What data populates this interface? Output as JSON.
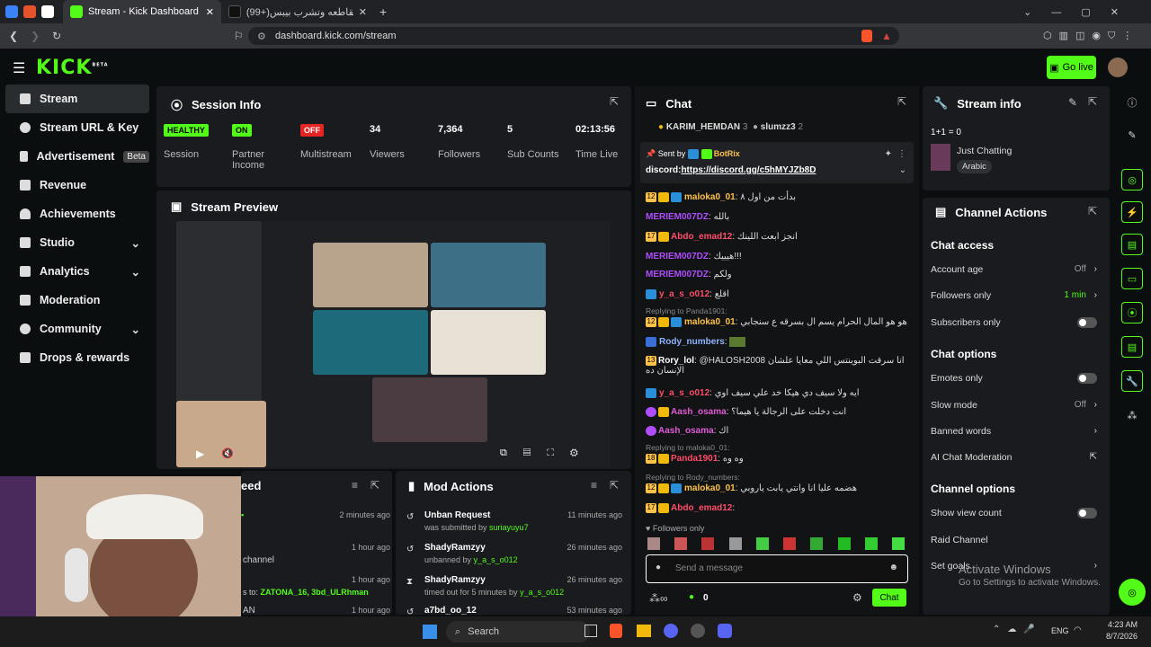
{
  "browser": {
    "tab1": "Stream - Kick Dashboard",
    "tab2": "(99+)متتاش المقاطعه وتشرب بيبس",
    "url": "dashboard.kick.com/stream"
  },
  "header": {
    "logo": "KICK",
    "logo_sup": "BETA",
    "go_live": "Go live"
  },
  "sidebar": {
    "items": [
      {
        "label": "Stream"
      },
      {
        "label": "Stream URL & Key"
      },
      {
        "label": "Advertisement",
        "badge": "Beta"
      },
      {
        "label": "Revenue"
      },
      {
        "label": "Achievements"
      },
      {
        "label": "Studio"
      },
      {
        "label": "Analytics"
      },
      {
        "label": "Moderation"
      },
      {
        "label": "Community"
      },
      {
        "label": "Drops & rewards"
      }
    ]
  },
  "session": {
    "title": "Session Info",
    "stats": [
      {
        "value": "HEALTHY",
        "label": "Session"
      },
      {
        "value": "ON",
        "label": "Partner Income"
      },
      {
        "value": "OFF",
        "label": "Multistream"
      },
      {
        "value": "34",
        "label": "Viewers"
      },
      {
        "value": "7,364",
        "label": "Followers"
      },
      {
        "value": "5",
        "label": "Sub Counts"
      },
      {
        "value": "02:13:56",
        "label": "Time Live"
      }
    ]
  },
  "preview": {
    "title": "Stream Preview"
  },
  "feed": {
    "title": "eed",
    "rows": [
      {
        "time": "2 minutes ago"
      },
      {
        "time": "1 hour ago",
        "text": "channel"
      },
      {
        "time": "1 hour ago",
        "text": "s to:",
        "hl": "ZATONA_16, 3bd_ULRhman"
      },
      {
        "text": "AN",
        "time": "1 hour ago"
      }
    ]
  },
  "modactions": {
    "title": "Mod Actions",
    "rows": [
      {
        "title": "Unban Request",
        "sub": "was submitted by",
        "user": "suriayuyu7",
        "time": "11 minutes ago"
      },
      {
        "title": "ShadyRamzyy",
        "sub": "unbanned by",
        "user": "y_a_s_o012",
        "time": "26 minutes ago"
      },
      {
        "title": "ShadyRamzyy",
        "sub": "timed out for 5 minutes by",
        "user": "y_a_s_o012",
        "time": "26 minutes ago"
      },
      {
        "title": "a7bd_oo_12",
        "time": "53 minutes ago"
      }
    ]
  },
  "chat": {
    "title": "Chat",
    "top_users": [
      {
        "name": "KARIM_HEMDAN",
        "n": "3"
      },
      {
        "name": "slumzz3",
        "n": "2"
      }
    ],
    "pinned": {
      "sent_by": "Sent by",
      "bot": "BotRix",
      "text": "discord:",
      "link": "https://discord.gg/c5hMYJZb8D"
    },
    "messages": [
      {
        "lvl": "12",
        "user": "maloka0_01",
        "text": "بدأت من اول ٨",
        "color": "#ffc24a"
      },
      {
        "user": "MERIEM007DZ",
        "text": "بالله",
        "color": "#b04dff"
      },
      {
        "lvl": "17",
        "user": "Abdo_emad12",
        "text": "انجز ابعت اللينك",
        "color": "#ff4d6a"
      },
      {
        "user": "MERIEM007DZ",
        "text": "هيييك!!!",
        "color": "#b04dff"
      },
      {
        "user": "MERIEM007DZ",
        "text": "ولكم",
        "color": "#b04dff"
      },
      {
        "user": "y_a_s_o012",
        "text": "اقلع",
        "color": "#ff4d6a"
      },
      {
        "lvl": "12",
        "user": "maloka0_01",
        "text": "هو هو المال الحرام يسم ال بسرقه ع سنجابي",
        "color": "#ffc24a",
        "reply": "Replying to Panda1901:"
      },
      {
        "user": "Rody_numbers",
        "text": "",
        "color": "#8fb4ff"
      },
      {
        "lvl": "13",
        "user": "Rory_lol",
        "text": "@HALOSH2008 انا سرقت البوينتس اللي معايا علشان الإنسان ده",
        "color": "#fff"
      },
      {
        "user": "y_a_s_o012",
        "text": "ايه ولا سيف دي هيكا خد علي سيف اوي",
        "color": "#ff4d6a"
      },
      {
        "user": "Aash_osama",
        "text": "انت دخلت على الرجالة يا هيما؟",
        "color": "#e05ad8"
      },
      {
        "user": "Aash_osama",
        "text": "اك",
        "color": "#e05ad8"
      },
      {
        "lvl": "18",
        "user": "Panda1901",
        "text": "وه وه",
        "color": "#ff4d6a",
        "reply": "Replying to maloka0_01:"
      },
      {
        "lvl": "12",
        "user": "maloka0_01",
        "text": "هضمه عليا انا وانتي يابت ياروبي",
        "color": "#ffc24a",
        "reply": "Replying to Rody_numbers:"
      },
      {
        "lvl": "17",
        "user": "Abdo_emad12",
        "text": "",
        "color": "#ff4d6a"
      }
    ],
    "followers_only": "Followers only",
    "input_placeholder": "Send a message",
    "points": "0",
    "chat_button": "Chat"
  },
  "stream_info": {
    "title": "Stream info",
    "stream_title": "1+1 = 0",
    "category": "Just Chatting",
    "tag": "Arabic"
  },
  "channel_actions": {
    "title": "Channel Actions",
    "chat_access": "Chat access",
    "account_age": "Account age",
    "account_age_val": "Off",
    "followers_only": "Followers only",
    "followers_only_val": "1 min",
    "subscribers_only": "Subscribers only",
    "chat_options": "Chat options",
    "emotes_only": "Emotes only",
    "slow_mode": "Slow mode",
    "slow_mode_val": "Off",
    "banned_words": "Banned words",
    "ai_mod": "AI Chat Moderation",
    "channel_options": "Channel options",
    "show_view_count": "Show view count",
    "raid_channel": "Raid Channel",
    "set_goals": "Set goals"
  },
  "watermark": {
    "line1": "Activate Windows",
    "line2": "Go to Settings to activate Windows."
  },
  "taskbar": {
    "search": "Search",
    "lang": "ENG",
    "time": "4:23 AM",
    "date": "8/7/2026"
  },
  "colors": {
    "accent": "#53fc18",
    "panel": "#191b1f",
    "bg": "#0b0e0f"
  }
}
